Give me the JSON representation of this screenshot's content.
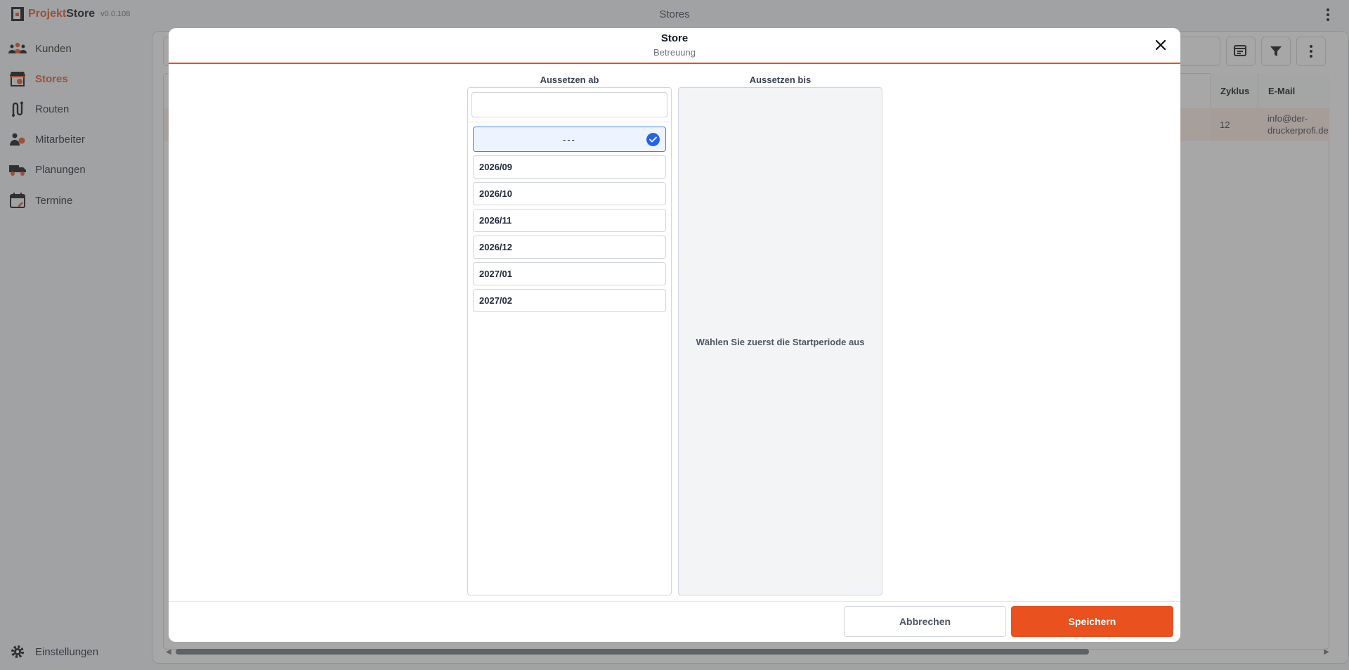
{
  "app": {
    "logo_part1": "Projekt",
    "logo_part2": "Store",
    "version": "v0.0.108",
    "title": "Stores",
    "accent_color": "#e9511f"
  },
  "sidebar": {
    "items": [
      {
        "label": "Kunden",
        "icon": "users-icon",
        "active": false
      },
      {
        "label": "Stores",
        "icon": "store-icon",
        "active": true
      },
      {
        "label": "Routen",
        "icon": "route-icon",
        "active": false
      },
      {
        "label": "Mitarbeiter",
        "icon": "employees-icon",
        "active": false
      },
      {
        "label": "Planungen",
        "icon": "truck-icon",
        "active": false
      },
      {
        "label": "Termine",
        "icon": "calendar-icon",
        "active": false
      }
    ],
    "settings_label": "Einstellungen"
  },
  "table": {
    "headers": [
      "Zyklus",
      "E-Mail"
    ],
    "row": {
      "zyklus": "12",
      "email_line1": "info@der-",
      "email_line2": "druckerprofi.de"
    }
  },
  "modal": {
    "title": "Store",
    "subtitle": "Betreuung",
    "from_label": "Aussetzen ab",
    "to_label": "Aussetzen bis",
    "search_value": "",
    "selected_option": "---",
    "options": [
      "2026/09",
      "2026/10",
      "2026/11",
      "2026/12",
      "2027/01",
      "2027/02"
    ],
    "to_placeholder": "Wählen Sie zuerst die Startperiode aus",
    "cancel_label": "Abbrechen",
    "save_label": "Speichern"
  }
}
